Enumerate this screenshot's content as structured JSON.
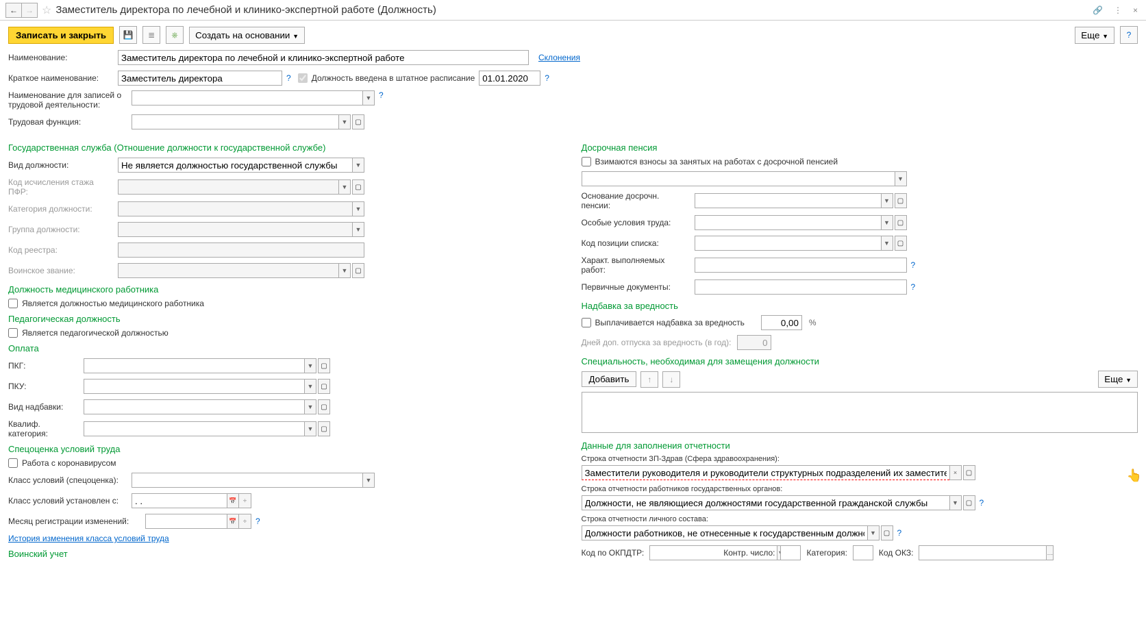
{
  "title": "Заместитель директора по лечебной и клинико-экспертной работе (Должность)",
  "toolbar": {
    "save_close": "Записать и закрыть",
    "create_based": "Создать на основании",
    "more": "Еще",
    "help": "?"
  },
  "fields": {
    "name_label": "Наименование:",
    "name_value": "Заместитель директора по лечебной и клинико-экспертной работе",
    "declensions": "Склонения",
    "short_name_label": "Краткое наименование:",
    "short_name_value": "Заместитель директора",
    "in_schedule_label": "Должность введена в штатное расписание",
    "in_schedule_date": "01.01.2020",
    "labor_record_label": "Наименование для записей о трудовой деятельности:",
    "labor_function_label": "Трудовая функция:"
  },
  "gov_service": {
    "header": "Государственная служба (Отношение должности к государственной службе)",
    "type_label": "Вид должности:",
    "type_value": "Не является должностью государственной службы",
    "pfr_code_label": "Код исчисления стажа ПФР:",
    "category_label": "Категория должности:",
    "group_label": "Группа должности:",
    "registry_label": "Код реестра:",
    "military_rank_label": "Воинское звание:"
  },
  "medical": {
    "header": "Должность медицинского работника",
    "is_medical_label": "Является должностью медицинского работника"
  },
  "pedagogical": {
    "header": "Педагогическая должность",
    "is_pedagogical_label": "Является педагогической должностью"
  },
  "payment": {
    "header": "Оплата",
    "pkg_label": "ПКГ:",
    "pku_label": "ПКУ:",
    "allowance_type_label": "Вид надбавки:",
    "qualif_category_label": "Квалиф. категория:"
  },
  "special_assessment": {
    "header": "Спецоценка условий труда",
    "covid_label": "Работа с коронавирусом",
    "class_label": "Класс условий (спецоценка):",
    "class_set_from_label": "Класс условий установлен с:",
    "class_set_from_value": ". .",
    "reg_month_label": "Месяц регистрации изменений:",
    "history_link": "История изменения класса условий труда"
  },
  "military_reg": {
    "header": "Воинский учет"
  },
  "early_pension": {
    "header": "Досрочная пенсия",
    "contributions_label": "Взимаются взносы за занятых на работах с досрочной пенсией",
    "basis_label": "Основание досрочн. пенсии:",
    "conditions_label": "Особые условия труда:",
    "list_position_label": "Код позиции списка:",
    "work_nature_label": "Характ. выполняемых работ:",
    "primary_docs_label": "Первичные документы:"
  },
  "hazard": {
    "header": "Надбавка за вредность",
    "paid_label": "Выплачивается надбавка за вредность",
    "amount": "0,00",
    "percent": "%",
    "extra_days_label": "Дней доп. отпуска за вредность (в год):",
    "extra_days_value": "0"
  },
  "specialty": {
    "header": "Специальность, необходимая для замещения должности",
    "add": "Добавить",
    "more": "Еще"
  },
  "reporting": {
    "header": "Данные для заполнения отчетности",
    "zp_zdrav_label": "Строка отчетности ЗП-Здрав (Сфера здравоохранения):",
    "zp_zdrav_value": "Заместители руководителя и руководители структурных подразделений их заместители, иные руков",
    "gov_workers_label": "Строка отчетности работников государственных органов:",
    "gov_workers_value": "Должности, не являющиеся должностями государственной гражданской службы",
    "personnel_label": "Строка отчетности личного состава:",
    "personnel_value": "Должности работников, не отнесенные к государственным должностям",
    "okpdtr_label": "Код по ОКПДТР:",
    "control_num_label": "Контр. число:",
    "category_label": "Категория:",
    "okz_label": "Код ОКЗ:"
  }
}
